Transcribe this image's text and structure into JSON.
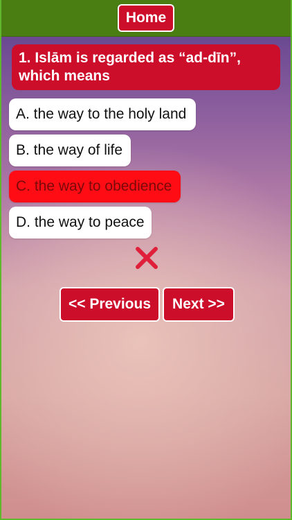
{
  "header": {
    "home_label": "Home"
  },
  "question": {
    "text": "1. Islām is regarded as “ad-dīn”, which means"
  },
  "options": [
    {
      "label": "A. the way to the holy land"
    },
    {
      "label": "B. the way of life"
    },
    {
      "label": "C. the way to obedience",
      "state": "selected-wrong"
    },
    {
      "label": "D. the way to peace"
    }
  ],
  "result": {
    "icon": "wrong-answer-icon",
    "color": "#e0203a"
  },
  "navigation": {
    "previous_label": "<< Previous",
    "next_label": "Next >>"
  },
  "colors": {
    "header_bg": "#4a7d12",
    "accent_red": "#cc0e2b",
    "wrong_selected": "#ff0c15"
  }
}
